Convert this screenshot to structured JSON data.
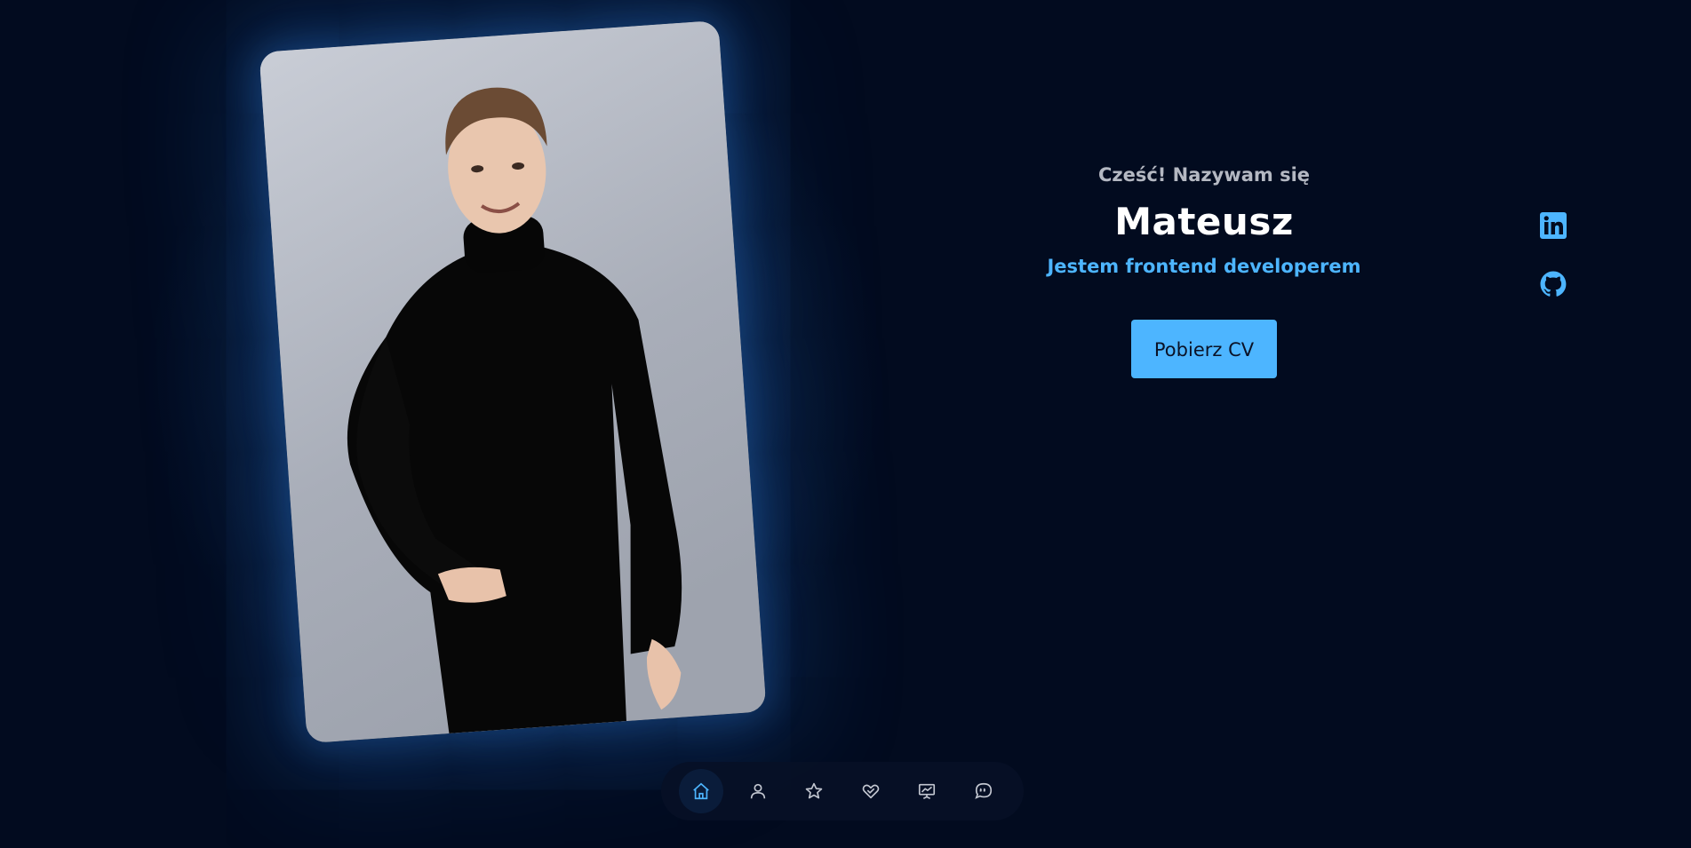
{
  "hero": {
    "greeting": "Cześć! Nazywam się",
    "name": "Mateusz",
    "role": "Jestem frontend developerem",
    "cv_button": "Pobierz CV"
  },
  "socials": [
    {
      "icon": "linkedin-icon"
    },
    {
      "icon": "github-icon"
    }
  ],
  "nav": {
    "items": [
      {
        "icon": "home-icon",
        "active": true
      },
      {
        "icon": "user-icon",
        "active": false
      },
      {
        "icon": "star-icon",
        "active": false
      },
      {
        "icon": "heart-hand-icon",
        "active": false
      },
      {
        "icon": "presentation-icon",
        "active": false
      },
      {
        "icon": "chat-quote-icon",
        "active": false
      }
    ]
  },
  "colors": {
    "background": "#020b1f",
    "accent": "#4db5ff",
    "text": "#ffffff",
    "muted": "#b4b8c2"
  }
}
